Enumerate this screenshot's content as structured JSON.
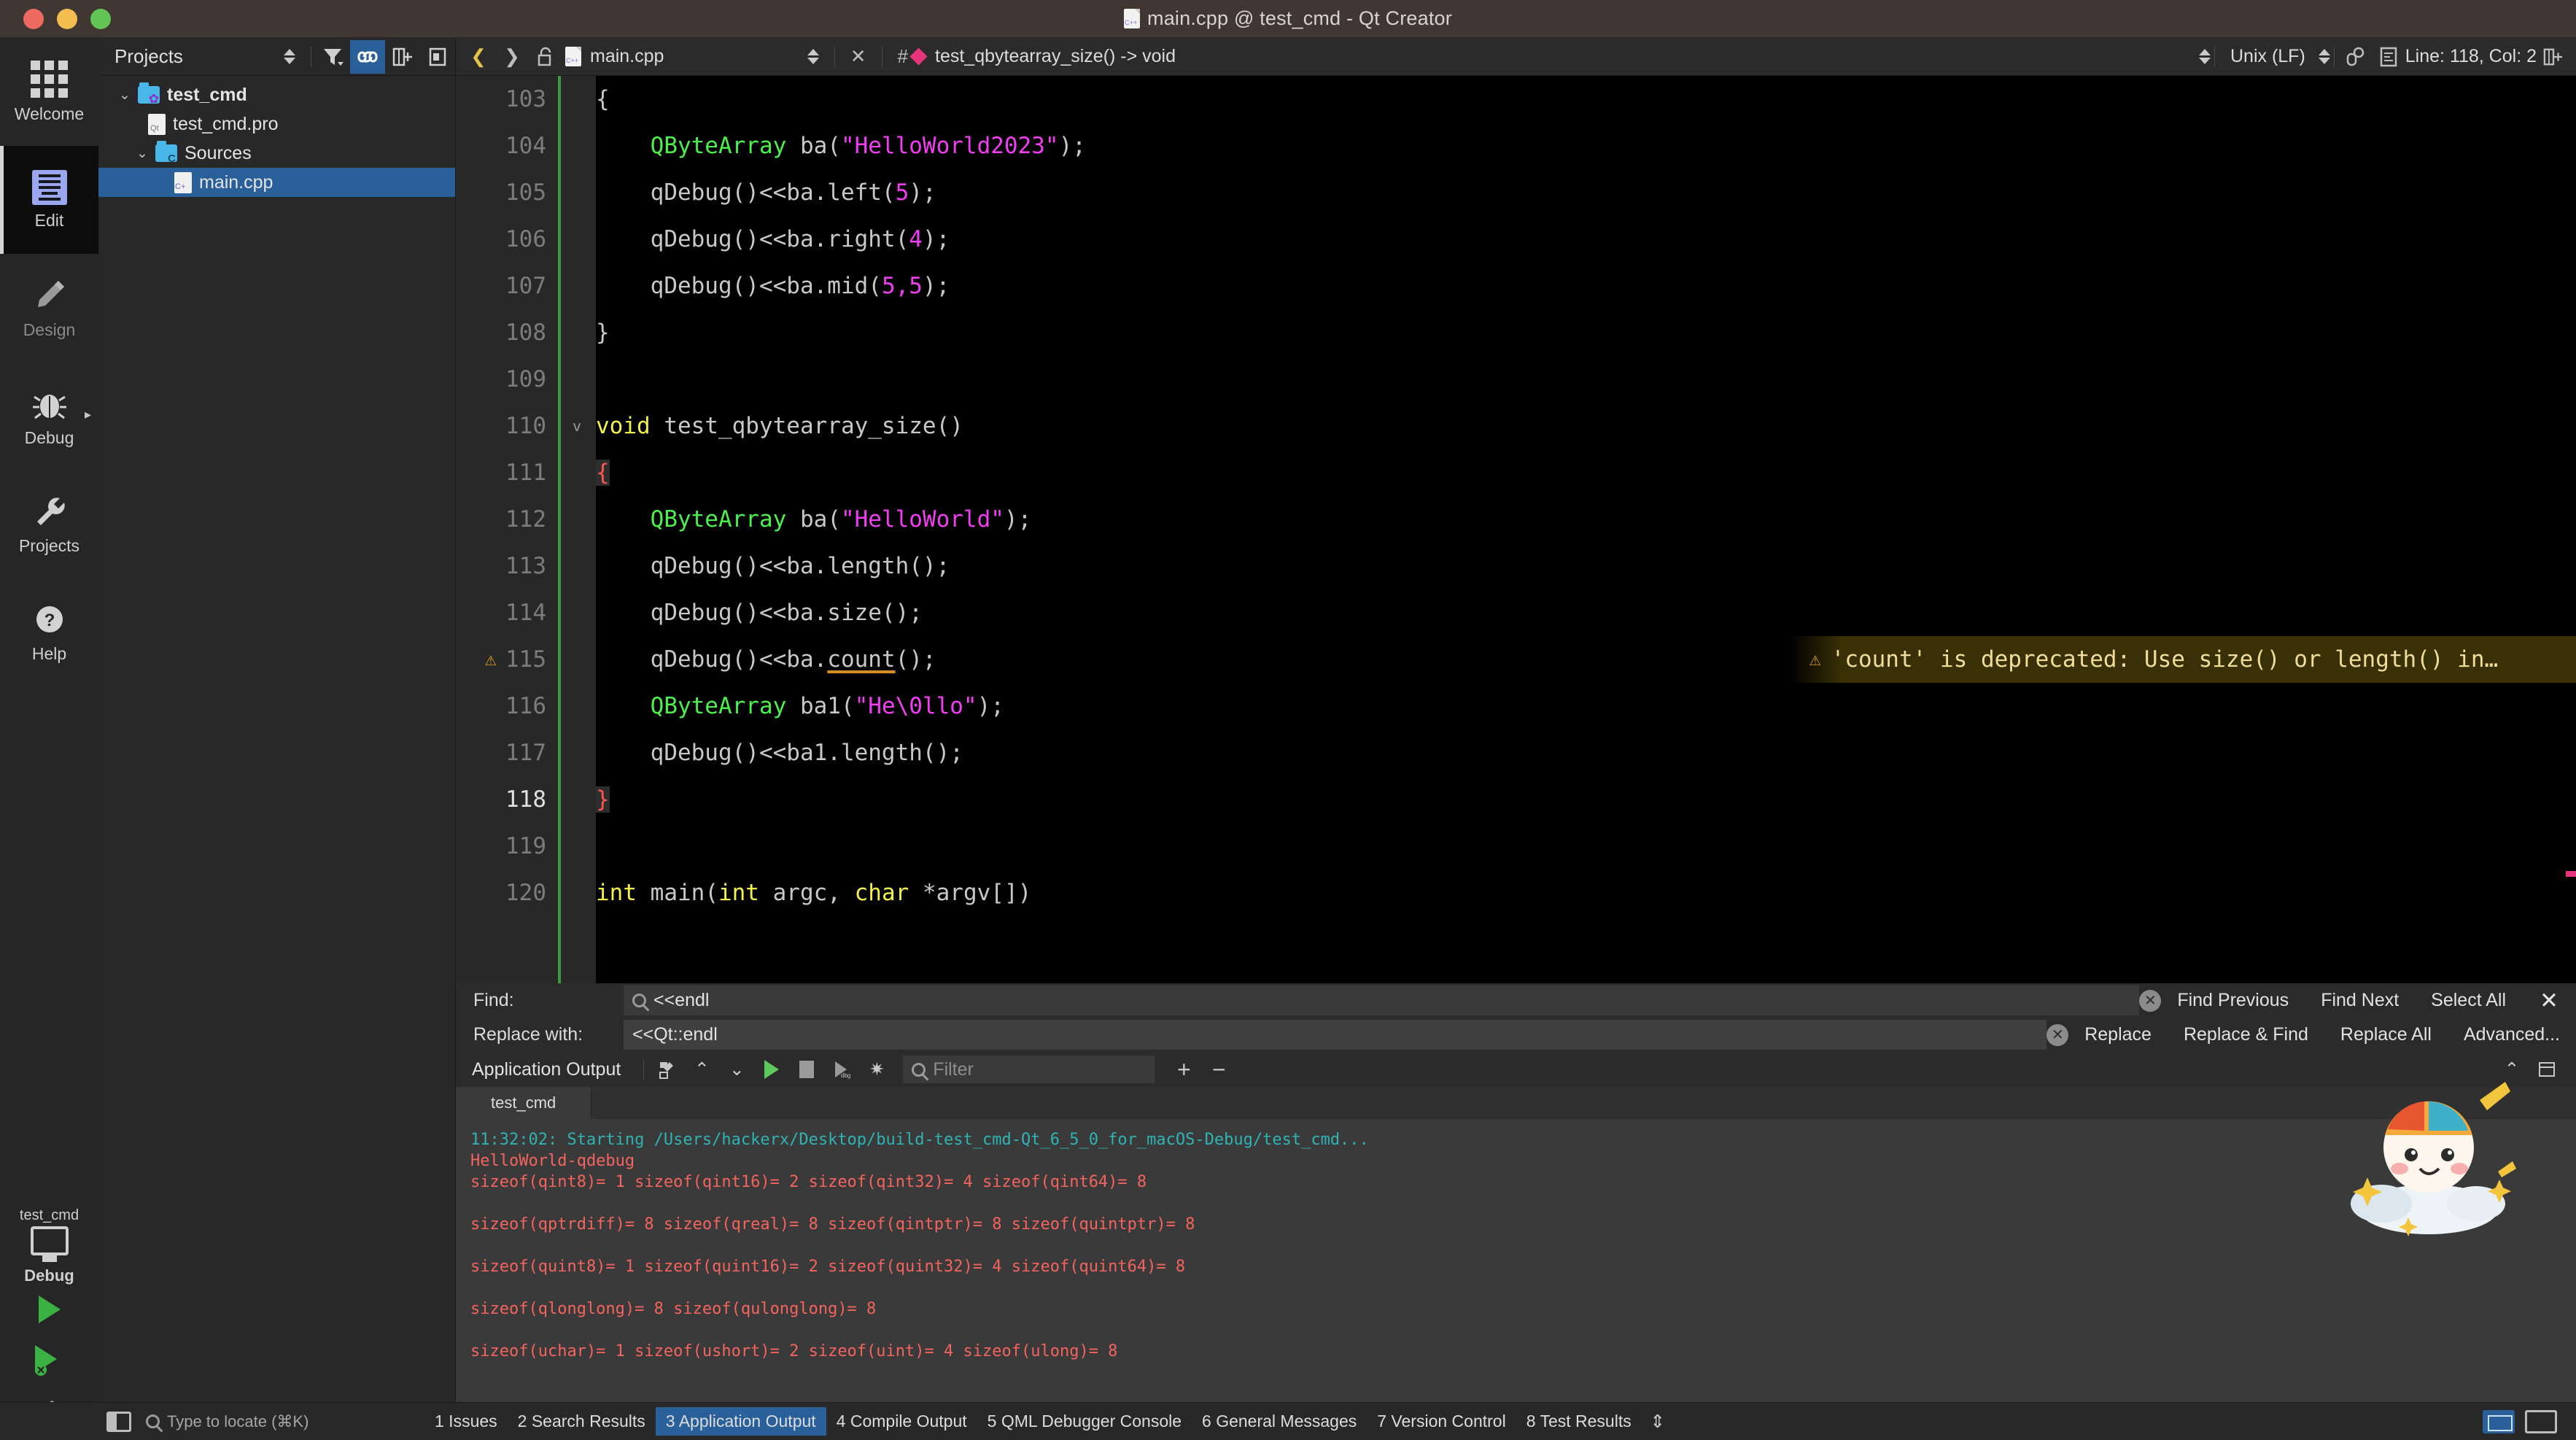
{
  "window": {
    "title": "main.cpp @ test_cmd - Qt Creator",
    "traffic": [
      "close",
      "minimize",
      "zoom"
    ]
  },
  "activity_bar": {
    "items": [
      {
        "label": "Welcome",
        "icon": "grid-icon",
        "active": false
      },
      {
        "label": "Edit",
        "icon": "edit-document-icon",
        "active": true
      },
      {
        "label": "Design",
        "icon": "pencil-icon",
        "active": false
      },
      {
        "label": "Debug",
        "icon": "bug-icon",
        "active": false
      },
      {
        "label": "Projects",
        "icon": "wrench-icon",
        "active": false
      },
      {
        "label": "Help",
        "icon": "question-mark-icon",
        "active": false
      }
    ],
    "kit": {
      "project": "test_cmd",
      "config": "Debug",
      "icon": "monitor-icon"
    },
    "run_button": "run-icon",
    "debug_button": "run-debug-icon",
    "build_button": "hammer-icon"
  },
  "project_panel": {
    "title": "Projects",
    "toolbar": [
      {
        "icon": "filter-icon",
        "name": "filter-tree-button",
        "selected": false
      },
      {
        "icon": "link-icon",
        "name": "synchronize-selection-button",
        "selected": true
      },
      {
        "icon": "split-add-icon",
        "name": "add-split-button",
        "selected": false
      },
      {
        "icon": "close-sidebar-icon",
        "name": "close-sidebar-button",
        "selected": false
      }
    ],
    "tree": [
      {
        "label": "test_cmd",
        "icon": "project-folder-icon",
        "depth": 0,
        "expanded": true,
        "bold": true,
        "selected": false
      },
      {
        "label": "test_cmd.pro",
        "icon": "qt-project-file-icon",
        "depth": 1,
        "expanded": null,
        "bold": false,
        "selected": false
      },
      {
        "label": "Sources",
        "icon": "sources-folder-icon",
        "depth": 1,
        "expanded": true,
        "bold": false,
        "selected": false
      },
      {
        "label": "main.cpp",
        "icon": "cpp-file-icon",
        "depth": 2,
        "expanded": null,
        "bold": false,
        "selected": true
      }
    ]
  },
  "editor_toolbar": {
    "nav_back": "chevron-left-icon",
    "nav_forward": "chevron-right-icon",
    "lock": "unlocked-icon",
    "file_icon": "cpp-file-icon",
    "file_name": "main.cpp",
    "close_icon": "close-editor-icon",
    "hash_icon": "hash-icon",
    "symbol": "test_qbytearray_size() -> void",
    "encoding": "Unix (LF)",
    "line_col": "Line: 118, Col: 2",
    "split_icon": "split-editor-icon"
  },
  "code": {
    "lines": [
      {
        "num": "103",
        "fold": "",
        "warn": false,
        "current": false,
        "tokens": [
          {
            "t": "{",
            "c": "plain"
          }
        ]
      },
      {
        "num": "104",
        "fold": "",
        "warn": false,
        "current": false,
        "tokens": [
          {
            "t": "    ",
            "c": "plain"
          },
          {
            "t": "QByteArray",
            "c": "type"
          },
          {
            "t": " ba(",
            "c": "plain"
          },
          {
            "t": "\"HelloWorld2023\"",
            "c": "str"
          },
          {
            "t": ");",
            "c": "plain"
          }
        ]
      },
      {
        "num": "105",
        "fold": "",
        "warn": false,
        "current": false,
        "tokens": [
          {
            "t": "    qDebug()<<ba.left(",
            "c": "plain"
          },
          {
            "t": "5",
            "c": "num"
          },
          {
            "t": ");",
            "c": "plain"
          }
        ]
      },
      {
        "num": "106",
        "fold": "",
        "warn": false,
        "current": false,
        "tokens": [
          {
            "t": "    qDebug()<<ba.right(",
            "c": "plain"
          },
          {
            "t": "4",
            "c": "num"
          },
          {
            "t": ");",
            "c": "plain"
          }
        ]
      },
      {
        "num": "107",
        "fold": "",
        "warn": false,
        "current": false,
        "tokens": [
          {
            "t": "    qDebug()<<ba.mid(",
            "c": "plain"
          },
          {
            "t": "5,5",
            "c": "num"
          },
          {
            "t": ");",
            "c": "plain"
          }
        ]
      },
      {
        "num": "108",
        "fold": "",
        "warn": false,
        "current": false,
        "tokens": [
          {
            "t": "}",
            "c": "plain"
          }
        ]
      },
      {
        "num": "109",
        "fold": "",
        "warn": false,
        "current": false,
        "tokens": []
      },
      {
        "num": "110",
        "fold": "v",
        "warn": false,
        "current": false,
        "tokens": [
          {
            "t": "void",
            "c": "kw"
          },
          {
            "t": " test_qbytearray_size()",
            "c": "plain"
          }
        ]
      },
      {
        "num": "111",
        "fold": "",
        "warn": false,
        "current": false,
        "tokens": [
          {
            "t": "{",
            "c": "brace"
          }
        ]
      },
      {
        "num": "112",
        "fold": "",
        "warn": false,
        "current": false,
        "tokens": [
          {
            "t": "    ",
            "c": "plain"
          },
          {
            "t": "QByteArray",
            "c": "type"
          },
          {
            "t": " ba(",
            "c": "plain"
          },
          {
            "t": "\"HelloWorld\"",
            "c": "str"
          },
          {
            "t": ");",
            "c": "plain"
          }
        ]
      },
      {
        "num": "113",
        "fold": "",
        "warn": false,
        "current": false,
        "tokens": [
          {
            "t": "    qDebug()<<ba.length();",
            "c": "plain"
          }
        ]
      },
      {
        "num": "114",
        "fold": "",
        "warn": false,
        "current": false,
        "tokens": [
          {
            "t": "    qDebug()<<ba.size();",
            "c": "plain"
          }
        ]
      },
      {
        "num": "115",
        "fold": "",
        "warn": true,
        "current": false,
        "tokens": [
          {
            "t": "    qDebug()<<ba.",
            "c": "plain"
          },
          {
            "t": "count",
            "c": "dep"
          },
          {
            "t": "();",
            "c": "plain"
          }
        ],
        "annotation": "'count' is deprecated: Use size() or length() in…"
      },
      {
        "num": "116",
        "fold": "",
        "warn": false,
        "current": false,
        "tokens": [
          {
            "t": "    ",
            "c": "plain"
          },
          {
            "t": "QByteArray",
            "c": "type"
          },
          {
            "t": " ba1(",
            "c": "plain"
          },
          {
            "t": "\"He\\0llo\"",
            "c": "str"
          },
          {
            "t": ");",
            "c": "plain"
          }
        ]
      },
      {
        "num": "117",
        "fold": "",
        "warn": false,
        "current": false,
        "tokens": [
          {
            "t": "    qDebug()<<ba1.length();",
            "c": "plain"
          }
        ]
      },
      {
        "num": "118",
        "fold": "",
        "warn": false,
        "current": true,
        "tokens": [
          {
            "t": "}",
            "c": "brace"
          }
        ]
      },
      {
        "num": "119",
        "fold": "",
        "warn": false,
        "current": false,
        "tokens": []
      },
      {
        "num": "120",
        "fold": "",
        "warn": false,
        "current": false,
        "tokens": [
          {
            "t": "int",
            "c": "kw"
          },
          {
            "t": " main(",
            "c": "plain"
          },
          {
            "t": "int",
            "c": "kw"
          },
          {
            "t": " argc, ",
            "c": "plain"
          },
          {
            "t": "char",
            "c": "kw"
          },
          {
            "t": " *argv[])",
            "c": "plain"
          }
        ]
      }
    ]
  },
  "find_bar": {
    "find_label": "Find:",
    "find_value": "<<endl",
    "replace_label": "Replace with:",
    "replace_value": "<<Qt::endl",
    "find_buttons": [
      "Find Previous",
      "Find Next",
      "Select All"
    ],
    "replace_buttons": [
      "Replace",
      "Replace & Find",
      "Replace All",
      "Advanced..."
    ],
    "close_icon": "close-find-icon",
    "clear_icon": "clear-field-icon",
    "search_icon": "search-icon"
  },
  "output_pane": {
    "title": "Application Output",
    "toolbar_icons": [
      "clear-output-icon",
      "prev-item-icon",
      "next-item-icon",
      "run-icon",
      "stop-icon",
      "attach-debugger-icon",
      "settings-gear-icon"
    ],
    "filter_placeholder": "Filter",
    "zoom_in": "+",
    "zoom_out": "−",
    "maximize_icon": "maximize-pane-icon",
    "close_icon": "close-pane-icon",
    "tabs": [
      {
        "label": "test_cmd",
        "active": true
      }
    ],
    "console_lines": [
      {
        "text": "11:32:02: Starting /Users/hackerx/Desktop/build-test_cmd-Qt_6_5_0_for_macOS-Debug/test_cmd...",
        "color": "teal"
      },
      {
        "text": "HelloWorld-qdebug",
        "color": "red"
      },
      {
        "text": "sizeof(qint8)= 1 sizeof(qint16)= 2 sizeof(qint32)= 4 sizeof(qint64)= 8",
        "color": "red"
      },
      {
        "text": "",
        "color": "blank"
      },
      {
        "text": "sizeof(qptrdiff)= 8 sizeof(qreal)= 8 sizeof(qintptr)= 8 sizeof(quintptr)= 8",
        "color": "red"
      },
      {
        "text": "",
        "color": "blank"
      },
      {
        "text": "sizeof(quint8)= 1 sizeof(quint16)= 2 sizeof(quint32)= 4 sizeof(quint64)= 8",
        "color": "red"
      },
      {
        "text": "",
        "color": "blank"
      },
      {
        "text": "sizeof(qlonglong)= 8 sizeof(qulonglong)= 8",
        "color": "red"
      },
      {
        "text": "",
        "color": "blank"
      },
      {
        "text": "sizeof(uchar)= 1 sizeof(ushort)= 2 sizeof(uint)= 4 sizeof(ulong)= 8",
        "color": "red"
      }
    ]
  },
  "status_bar": {
    "sidebar_toggle_icon": "toggle-sidebar-icon",
    "locator_placeholder": "Type to locate (⌘K)",
    "search_icon": "search-icon",
    "tabs": [
      {
        "num": "1",
        "label": "Issues",
        "active": false
      },
      {
        "num": "2",
        "label": "Search Results",
        "active": false
      },
      {
        "num": "3",
        "label": "Application Output",
        "active": true
      },
      {
        "num": "4",
        "label": "Compile Output",
        "active": false
      },
      {
        "num": "5",
        "label": "QML Debugger Console",
        "active": false
      },
      {
        "num": "6",
        "label": "General Messages",
        "active": false
      },
      {
        "num": "7",
        "label": "Version Control",
        "active": false
      },
      {
        "num": "8",
        "label": "Test Results",
        "active": false
      }
    ],
    "overflow_icon": "more-panes-icon",
    "right_icons": [
      "show-output-pane-icon",
      "hide-output-pane-icon"
    ]
  },
  "colors": {
    "accent_blue": "#2a6099",
    "keyword_yellow": "#f2f24b",
    "type_green": "#4cf04c",
    "string_magenta": "#f23ef2",
    "warning_amber": "#d6a022",
    "console_red": "#f4645f",
    "console_teal": "#2fb3b3",
    "titlebar": "#403733"
  }
}
